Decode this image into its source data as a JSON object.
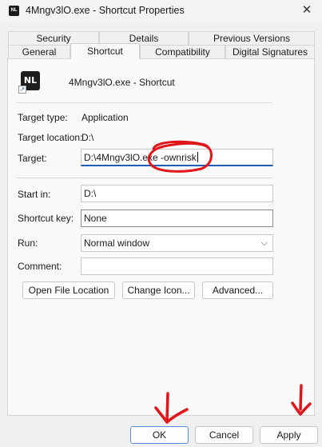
{
  "window": {
    "title": "4Mngv3lO.exe - Shortcut Properties",
    "icon_glyph": "NL",
    "close_glyph": "✕"
  },
  "tabs": {
    "row_top": [
      {
        "label": "Security"
      },
      {
        "label": "Details"
      },
      {
        "label": "Previous Versions"
      }
    ],
    "row_bottom": [
      {
        "label": "General"
      },
      {
        "label": "Shortcut",
        "active": true
      },
      {
        "label": "Compatibility"
      },
      {
        "label": "Digital Signatures"
      }
    ]
  },
  "header": {
    "icon_glyph": "NL",
    "arrow_glyph": "↗",
    "name": "4Mngv3lO.exe - Shortcut"
  },
  "props": {
    "target_type_label": "Target type:",
    "target_type_value": "Application",
    "target_location_label": "Target location:",
    "target_location_value": "D:\\",
    "target_label": "Target:",
    "target_value_part1": "D:\\4Mngv3lO.exe",
    "target_value_part2": " -ownrisk",
    "start_in_label": "Start in:",
    "start_in_value": "D:\\",
    "shortcut_key_label": "Shortcut key:",
    "shortcut_key_value": "None",
    "run_label": "Run:",
    "run_value": "Normal window",
    "run_chevron": "⌵",
    "comment_label": "Comment:",
    "comment_value": ""
  },
  "buttons": {
    "open_location": "Open File Location",
    "change_icon": "Change Icon...",
    "advanced": "Advanced...",
    "ok": "OK",
    "cancel": "Cancel",
    "apply": "Apply"
  },
  "colors": {
    "annotation_red": "#e0161b",
    "focus_blue": "#1f5eb8",
    "default_button_border": "#5a8ee0"
  }
}
